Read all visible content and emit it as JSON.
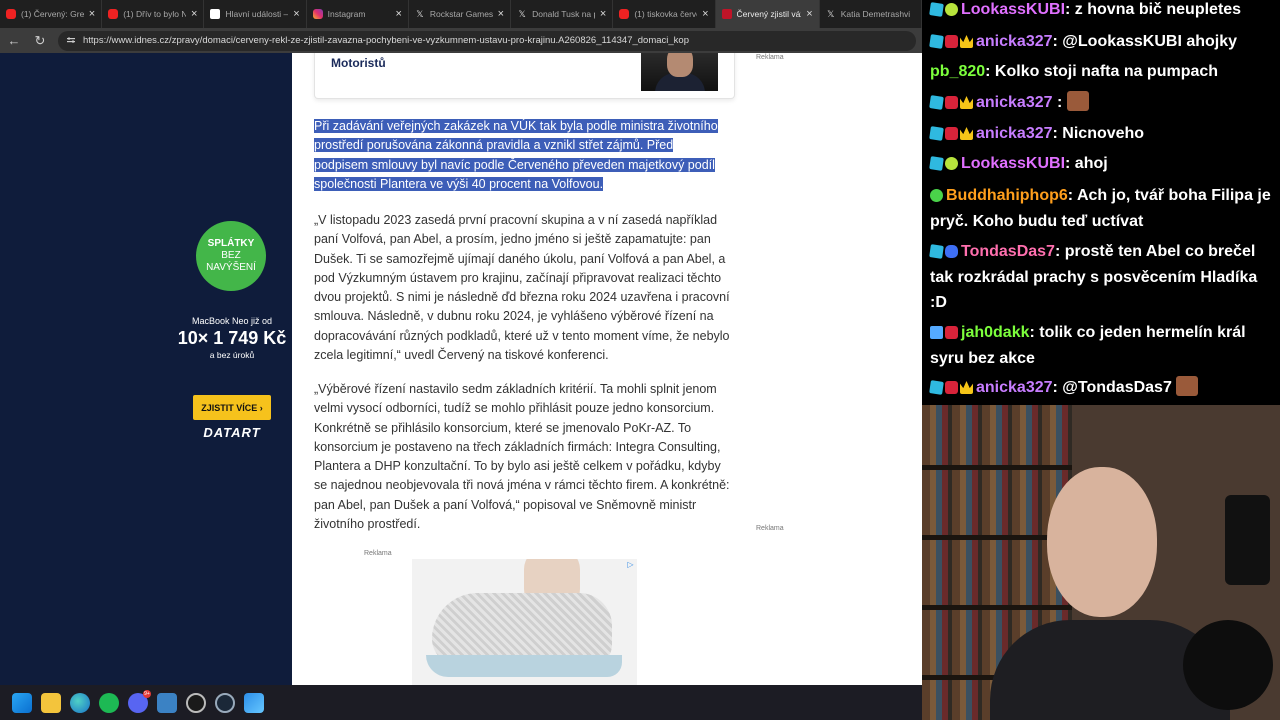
{
  "browser": {
    "tabs": [
      {
        "label": "(1) Červený: Green",
        "favicon": "youtube"
      },
      {
        "label": "(1) Dřív to bylo N",
        "favicon": "youtube"
      },
      {
        "label": "Hlavní události —",
        "favicon": "news"
      },
      {
        "label": "Instagram",
        "favicon": "instagram"
      },
      {
        "label": "Rockstar Games n",
        "favicon": "x"
      },
      {
        "label": "Donald Tusk na p",
        "favicon": "x"
      },
      {
        "label": "(1) tiskovka červe",
        "favicon": "youtube"
      },
      {
        "label": "Červený zjistil váž",
        "favicon": "idnes",
        "active": true
      },
      {
        "label": "Katia Demetrashvi",
        "favicon": "x"
      }
    ],
    "url": "https://www.idnes.cz/zpravy/domaci/cerveny-rekl-ze-zjistil-zavazna-pochybeni-ve-vyzkumnem-ustavu-pro-krajinu.A260826_114347_domaci_kop"
  },
  "left_ad": {
    "badge_line1": "SPLÁTKY",
    "badge_line2": "BEZ",
    "badge_line3": "NAVÝŠENÍ",
    "line1": "MacBook Neo již od",
    "price": "10× 1 749 Kč",
    "line3": "a bez úroků",
    "cta": "ZJISTIT VÍCE ›",
    "logo": "DATART"
  },
  "card": {
    "title": "Motoristů"
  },
  "reklama": "Reklama",
  "article": {
    "highlight_lines": [
      "Při zadávání veřejných zakázek na VÚK tak byla podle ministra životního",
      "prostředí porušována zákonná pravidla a vznikl střet zájmů. Před",
      "podpisem smlouvy byl navíc podle Červeného převeden majetkový podíl",
      "společnosti Plantera ve výši 40 procent na Volfovou."
    ],
    "para1": "„V listopadu 2023 zasedá první pracovní skupina a v ní zasedá například paní Volfová, pan Abel, a prosím, jedno jméno si ještě zapamatujte: pan Dušek. Ti se samozřejmě ujímají daného úkolu, paní Volfová a pan Abel, a pod Výzkumným ústavem pro krajinu, začínají připravovat realizaci těchto dvou projektů. S nimi je následně ďd března roku 2024 uzavřena i pracovní smlouva. Následně, v dubnu roku 2024, je vyhlášeno výběrové řízení na dopracovávání různých podkladů, které už v tento moment víme, že nebylo zcela legitimní,“ uvedl Červený na tiskové konferenci.",
    "para2": "„Výběrové řízení nastavilo sedm základních kritérií. Ta mohli splnit jenom velmi vysocí odborníci, tudíž se mohlo přihlásit pouze jedno konsorcium. Konkrétně se přihlásilo konsorcium, které se jmenovalo PoKr-AZ. To konsorcium je postaveno na třech základních firmách: Integra Consulting, Plantera a DHP konzultační. To by bylo asi ještě celkem v pořádku, kdyby se najednou neobjevovala tři nová jména v rámci těchto firem. A konkrétně: pan Abel, pan Dušek a paní Volfová,“ popisoval ve Sněmovně ministr životního prostředí."
  },
  "chat": {
    "messages": [
      {
        "user": "LookassKUBI",
        "color": "#e070ff",
        "badges": [
          "cube",
          "lime"
        ],
        "text": ": z hovna bič neupletes"
      },
      {
        "user": "anicka327",
        "color": "#c77dff",
        "badges": [
          "cube",
          "red",
          "crown"
        ],
        "text": ": @LookassKUBI ahojky"
      },
      {
        "user": "pb_820",
        "color": "#7cff3c",
        "badges": [],
        "text": ": Kolko stoji nafta na pumpach"
      },
      {
        "user": "anicka327",
        "color": "#c77dff",
        "badges": [
          "cube",
          "red",
          "crown"
        ],
        "text": " : ",
        "emote": true
      },
      {
        "user": "anicka327",
        "color": "#c77dff",
        "badges": [
          "cube",
          "red",
          "crown"
        ],
        "text": ": Nicnoveho"
      },
      {
        "user": "LookassKUBI",
        "color": "#e070ff",
        "badges": [
          "cube",
          "lime"
        ],
        "text": ": ahoj"
      },
      {
        "user": "Buddhahiphop6",
        "color": "#ff9f1c",
        "badges": [
          "green"
        ],
        "text": ": Ach jo, tvář boha Filipa je pryč. Koho budu teď uctívat"
      },
      {
        "user": "TondasDas7",
        "color": "#ff6fae",
        "badges": [
          "cube",
          "blue"
        ],
        "text": ": prostě ten Abel co brečel tak rozkrádal prachy s posvěcením Hladíka :D"
      },
      {
        "user": "jah0dakk",
        "color": "#7cff3c",
        "badges": [
          "rocket",
          "red"
        ],
        "text": ": tolik co jeden hermelín král syru bez akce"
      },
      {
        "user": "anicka327",
        "color": "#c77dff",
        "badges": [
          "cube",
          "red",
          "crown"
        ],
        "text": ": @TondasDas7 ",
        "emote": true
      }
    ]
  },
  "colors": {
    "highlight": "#3d5eb8",
    "ad_bg": "#0f1c3b",
    "cta": "#f6c21c",
    "badge_green": "#43b649"
  },
  "taskbar": {
    "icons": [
      "windows-icon",
      "file-explorer-icon",
      "edge-icon",
      "spotify-icon",
      "discord-icon",
      "notepad-icon",
      "github-icon",
      "steam-icon",
      "paint-icon"
    ],
    "discord_badge": "9+"
  }
}
